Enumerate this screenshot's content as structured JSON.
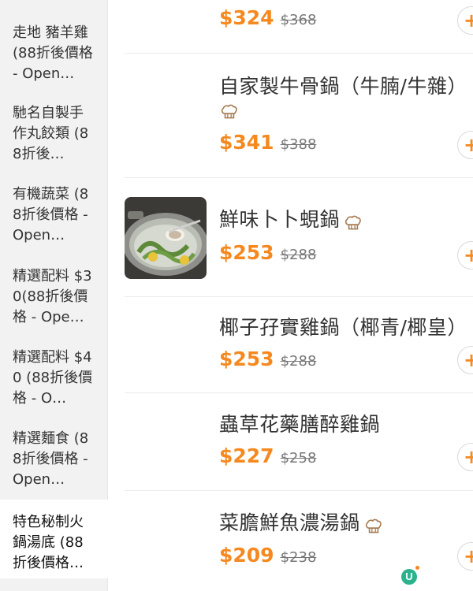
{
  "sidebar": {
    "items": [
      {
        "label": "走地 豬羊雞 (88折後價格 - Open…"
      },
      {
        "label": "馳名自製手作丸餃類 (88折後…"
      },
      {
        "label": "有機蔬菜 (88折後價格 - Open…"
      },
      {
        "label": "精選配料 $30(88折後價格 - Ope…"
      },
      {
        "label": "精選配料 $40 (88折後價格 - O…"
      },
      {
        "label": "精選麵食 (88折後價格 - Open…"
      },
      {
        "label": "特色秘制火鍋湯底 (88 折後價格…"
      }
    ],
    "active_index": 6
  },
  "menu": {
    "items": [
      {
        "name": "",
        "price": "$324",
        "original_price": "$368",
        "chef_icon": false,
        "image": false
      },
      {
        "name": "自家製牛骨鍋（牛腩/牛雜）",
        "price": "$341",
        "original_price": "$388",
        "chef_icon": true,
        "image": false
      },
      {
        "name": "鮮味卜卜蜆鍋",
        "price": "$253",
        "original_price": "$288",
        "chef_icon": true,
        "image": true
      },
      {
        "name": "椰子孖實雞鍋（椰青/椰皇）",
        "price": "$253",
        "original_price": "$288",
        "chef_icon": false,
        "image": false
      },
      {
        "name": "蟲草花藥膳醉雞鍋",
        "price": "$227",
        "original_price": "$258",
        "chef_icon": false,
        "image": false
      },
      {
        "name": "菜膽鮮魚濃湯鍋",
        "price": "$209",
        "original_price": "$238",
        "chef_icon": true,
        "image": false
      }
    ],
    "add_button_symbol": "+"
  },
  "badge": {
    "letter": "U"
  },
  "colors": {
    "accent": "#f5891f",
    "sidebar_bg": "#f2f2f2",
    "badge": "#2ab38c"
  },
  "icons": {
    "chef": "chef-hat-icon",
    "add": "plus-icon"
  }
}
